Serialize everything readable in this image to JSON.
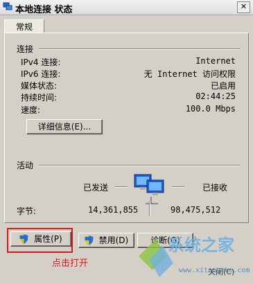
{
  "window": {
    "title": "本地连接 状态",
    "close_glyph": "✕"
  },
  "tabs": [
    {
      "label": "常规"
    }
  ],
  "connection": {
    "group_label": "连接",
    "rows": [
      {
        "label": "IPv4 连接:",
        "value": "Internet"
      },
      {
        "label": "IPv6 连接:",
        "value": "无 Internet 访问权限"
      },
      {
        "label": "媒体状态:",
        "value": "已启用"
      },
      {
        "label": "持续时间:",
        "value": "02:44:25"
      },
      {
        "label": "速度:",
        "value": "100.0 Mbps"
      }
    ],
    "details_button": "详细信息(E)..."
  },
  "activity": {
    "group_label": "活动",
    "sent_label": "已发送",
    "received_label": "已接收",
    "bytes_label": "字节:",
    "bytes_sent": "14,361,855",
    "bytes_received": "98,475,512",
    "network_icon": "network-computers-icon"
  },
  "buttons": {
    "properties": "属性(P)",
    "disable": "禁用(D)",
    "diagnose": "诊断(G)",
    "partial_bottom": "关闭(C)"
  },
  "annotation": {
    "text": "点击打开",
    "color": "#e0141b"
  },
  "watermark": {
    "text": "系统之家",
    "url": "www.xitongzhe.com"
  }
}
